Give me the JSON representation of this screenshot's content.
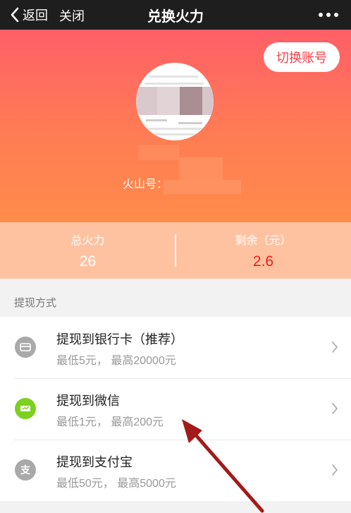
{
  "nav": {
    "back_label": "返回",
    "close_label": "关闭",
    "title": "兑换火力"
  },
  "header": {
    "switch_account_label": "切换账号",
    "id_label": "火山号："
  },
  "stats": {
    "total_label": "总火力",
    "total_value": "26",
    "remain_label": "剩余（元）",
    "remain_value": "2.6"
  },
  "section": {
    "label": "提现方式"
  },
  "options": [
    {
      "title": "提现到银行卡（推荐）",
      "subtitle": "最低5元，  最高20000元",
      "icon": "bank-card-icon",
      "color": "#a9a9a9"
    },
    {
      "title": "提现到微信",
      "subtitle": "最低1元，  最高200元",
      "icon": "wechat-icon",
      "color": "#7bd11d"
    },
    {
      "title": "提现到支付宝",
      "subtitle": "最低50元，  最高5000元",
      "icon": "alipay-icon",
      "color": "#a9a9a9"
    }
  ],
  "colors": {
    "accent": "#fb3f46",
    "nav_bg": "#1e1e1e",
    "stats_bg": "#ffc2a1",
    "annotation_arrow": "#a31a1a"
  }
}
